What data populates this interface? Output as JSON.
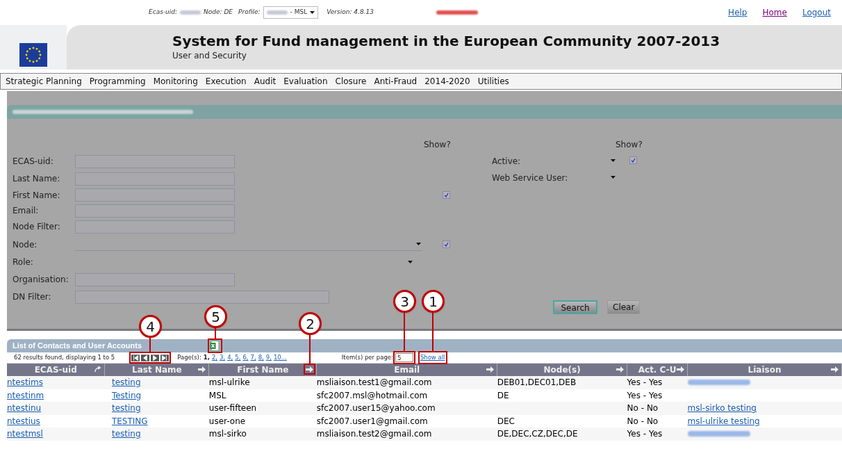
{
  "top_bar": {
    "ecas_label": "Ecas-uid:",
    "node": "Node: DE",
    "profile_label": "Profile:",
    "profile_value": "- MSL",
    "version": "Version: 4.8.13",
    "links": [
      {
        "label": "Help",
        "visited": false
      },
      {
        "label": "Home",
        "visited": true
      },
      {
        "label": "Logout",
        "visited": false
      }
    ]
  },
  "header": {
    "title": "System for Fund management in the European Community 2007-2013",
    "subtitle": "User and Security"
  },
  "menu": [
    "Strategic Planning",
    "Programming",
    "Monitoring",
    "Execution",
    "Audit",
    "Evaluation",
    "Closure",
    "Anti-Fraud",
    "2014-2020",
    "Utilities"
  ],
  "search_panel": {
    "show_heading": "Show?",
    "right_show_heading": "Show?",
    "fields": [
      {
        "kind": "text",
        "label": "ECAS-uid:",
        "show": false
      },
      {
        "kind": "text",
        "label": "Last Name:",
        "show": false
      },
      {
        "kind": "text",
        "label": "First Name:",
        "show": true
      },
      {
        "kind": "text",
        "label": "Email:",
        "show": false
      },
      {
        "kind": "text",
        "label": "Node Filter:",
        "show": false
      },
      {
        "kind": "select",
        "label": "Node:",
        "show": true
      },
      {
        "kind": "select",
        "label": "Role:",
        "show": false
      },
      {
        "kind": "text",
        "label": "Organisation:",
        "show": false
      },
      {
        "kind": "wide",
        "label": "DN Filter:",
        "show": false
      }
    ],
    "right_fields": [
      {
        "label": "Active:",
        "show": true
      },
      {
        "label": "Web Service User:",
        "show": false
      }
    ],
    "buttons": [
      "Search",
      "Clear"
    ]
  },
  "results": {
    "title": "List of Contacts and User Accounts",
    "summary": "62 results found, displaying 1 to 5",
    "pages_label": "Page(s):",
    "pages": [
      {
        "label": "1,",
        "selected": true
      },
      {
        "label": "2,",
        "selected": false
      },
      {
        "label": "3,",
        "selected": false
      },
      {
        "label": "4,",
        "selected": false
      },
      {
        "label": "5,",
        "selected": false
      },
      {
        "label": "6,",
        "selected": false
      },
      {
        "label": "7,",
        "selected": false
      },
      {
        "label": "8,",
        "selected": false
      },
      {
        "label": "9,",
        "selected": false
      },
      {
        "label": "10...",
        "selected": false
      }
    ],
    "per_page_label": "Item(s) per page:",
    "per_page": "5",
    "show_all": "Show all",
    "columns": [
      {
        "label": "ECAS-uid",
        "sorted": true
      },
      {
        "label": "Last Name",
        "sorted": false
      },
      {
        "label": "First Name",
        "sorted": false
      },
      {
        "label": "Email",
        "sorted": false
      },
      {
        "label": "Node(s)",
        "sorted": false
      },
      {
        "label": "Act. C-U",
        "sorted": false
      },
      {
        "label": "Liaison",
        "sorted": false
      }
    ],
    "rows": [
      {
        "ecas_uid": "ntestims",
        "last_name": "testing",
        "first_name": "msl-ulrike",
        "email": "msliaison.test1@gmail.com",
        "nodes": "DEB01,DEC01,DEB",
        "act": "Yes - Yes",
        "liaison": {
          "kind": "redacted"
        }
      },
      {
        "ecas_uid": "ntestinm",
        "last_name": "Testing",
        "first_name": "MSL",
        "email": "sfc2007.msl@hotmail.com",
        "nodes": "DE",
        "act": "Yes - Yes"
      },
      {
        "ecas_uid": "ntestinu",
        "last_name": "testing",
        "first_name": "user-fifteen",
        "email": "sfc2007.user15@yahoo.com",
        "act": "No - No",
        "liaison": {
          "kind": "link",
          "text": "msl-sirko testing"
        }
      },
      {
        "ecas_uid": "ntestius",
        "last_name": "TESTING",
        "first_name": "user-one",
        "email": "sfc2007.user1@gmail.com",
        "nodes": "DEC",
        "act": "No - No",
        "liaison": {
          "kind": "link",
          "text": "msl-ulrike testing"
        }
      },
      {
        "ecas_uid": "ntestmsl",
        "last_name": "testing",
        "first_name": "msl-sirko",
        "email": "msliaison.test2@gmail.com",
        "nodes": "DE,DEC,CZ,DEC,DE",
        "act": "Yes - Yes",
        "liaison": {
          "kind": "redacted"
        }
      }
    ]
  },
  "callouts": [
    {
      "label": "1"
    },
    {
      "label": "2"
    },
    {
      "label": "3"
    },
    {
      "label": "4"
    },
    {
      "label": "5"
    }
  ]
}
